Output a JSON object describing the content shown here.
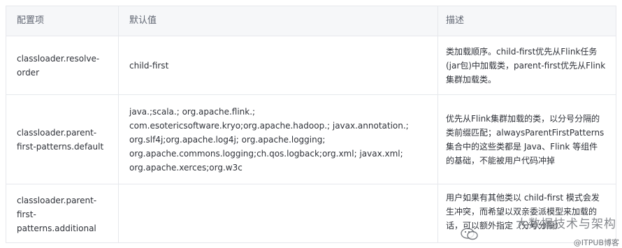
{
  "table": {
    "headers": [
      "配置项",
      "默认值",
      "描述"
    ],
    "rows": [
      {
        "key": [
          "classloader.resolve-",
          "order"
        ],
        "default": [
          "child-first"
        ],
        "desc": [
          "类加载顺序。child-first优先从Flink任务",
          "(jar包)中加载类，parent-first优先从Flink",
          "集群加载类。"
        ]
      },
      {
        "key": [
          "classloader.parent-",
          "first-patterns.default"
        ],
        "default": [
          "java.;scala.; org.apache.flink.;",
          "com.esotericsoftware.kryo;org.apache.hadoop.; javax.annotation.;",
          "org.slf4j;org.apache.log4j; org.apache.logging;",
          "org.apache.commons.logging;ch.qos.logback;org.xml; javax.xml;",
          "org.apache.xerces;org.w3c"
        ],
        "desc": [
          "优先从Flink集群加载的类，以分号分隔的",
          "类前缀匹配；alwaysParentFirstPatterns",
          "集合中的这些类都是 Java、Flink 等组件",
          "的基础，不能被用户代码冲掉"
        ]
      },
      {
        "key": [
          "classloader.parent-",
          "first-",
          "patterns.additional"
        ],
        "default": [],
        "desc": [
          "用户如果有其他类以 child-first 模式会发",
          "生冲突，而希望以双亲委派模型来加载的",
          "话，可以额外指定（分号分隔）"
        ]
      }
    ]
  },
  "watermark": {
    "main": "大数据技术与架构",
    "small": "@ITPUB博客",
    "icon": "wechat-icon"
  }
}
